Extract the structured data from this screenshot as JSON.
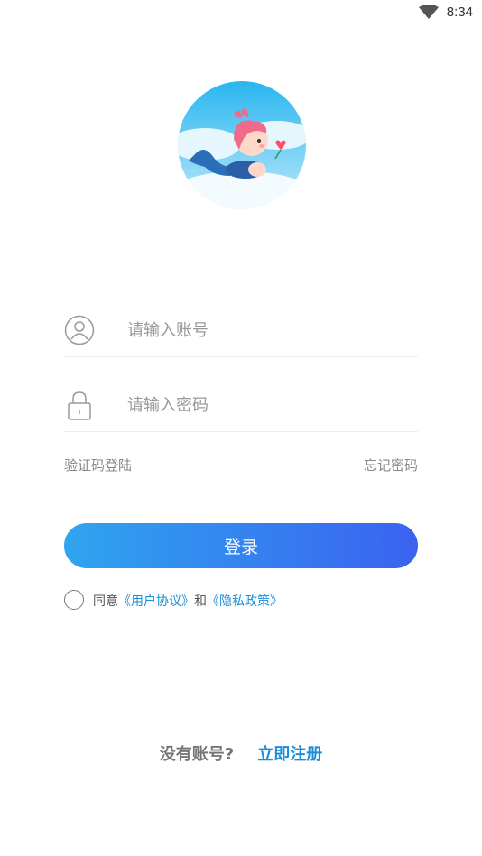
{
  "status_bar": {
    "time": "8:34",
    "wifi_icon": "wifi-icon"
  },
  "avatar": {
    "icon": "mermaid-avatar"
  },
  "form": {
    "account_placeholder": "请输入账号",
    "password_placeholder": "请输入密码",
    "account_icon": "user-icon",
    "password_icon": "lock-icon"
  },
  "links": {
    "sms_login": "验证码登陆",
    "forgot_password": "忘记密码"
  },
  "login_button": {
    "label": "登录",
    "gradient": [
      "#2fa5ef",
      "#3a62f0"
    ]
  },
  "agreement": {
    "prefix": "同意",
    "user_agreement": "《用户协议》",
    "and": "和",
    "privacy_policy": "《隐私政策》",
    "checked": false
  },
  "register": {
    "question": "没有账号?",
    "action": "立即注册"
  },
  "colors": {
    "accent": "#1a8fd8"
  }
}
